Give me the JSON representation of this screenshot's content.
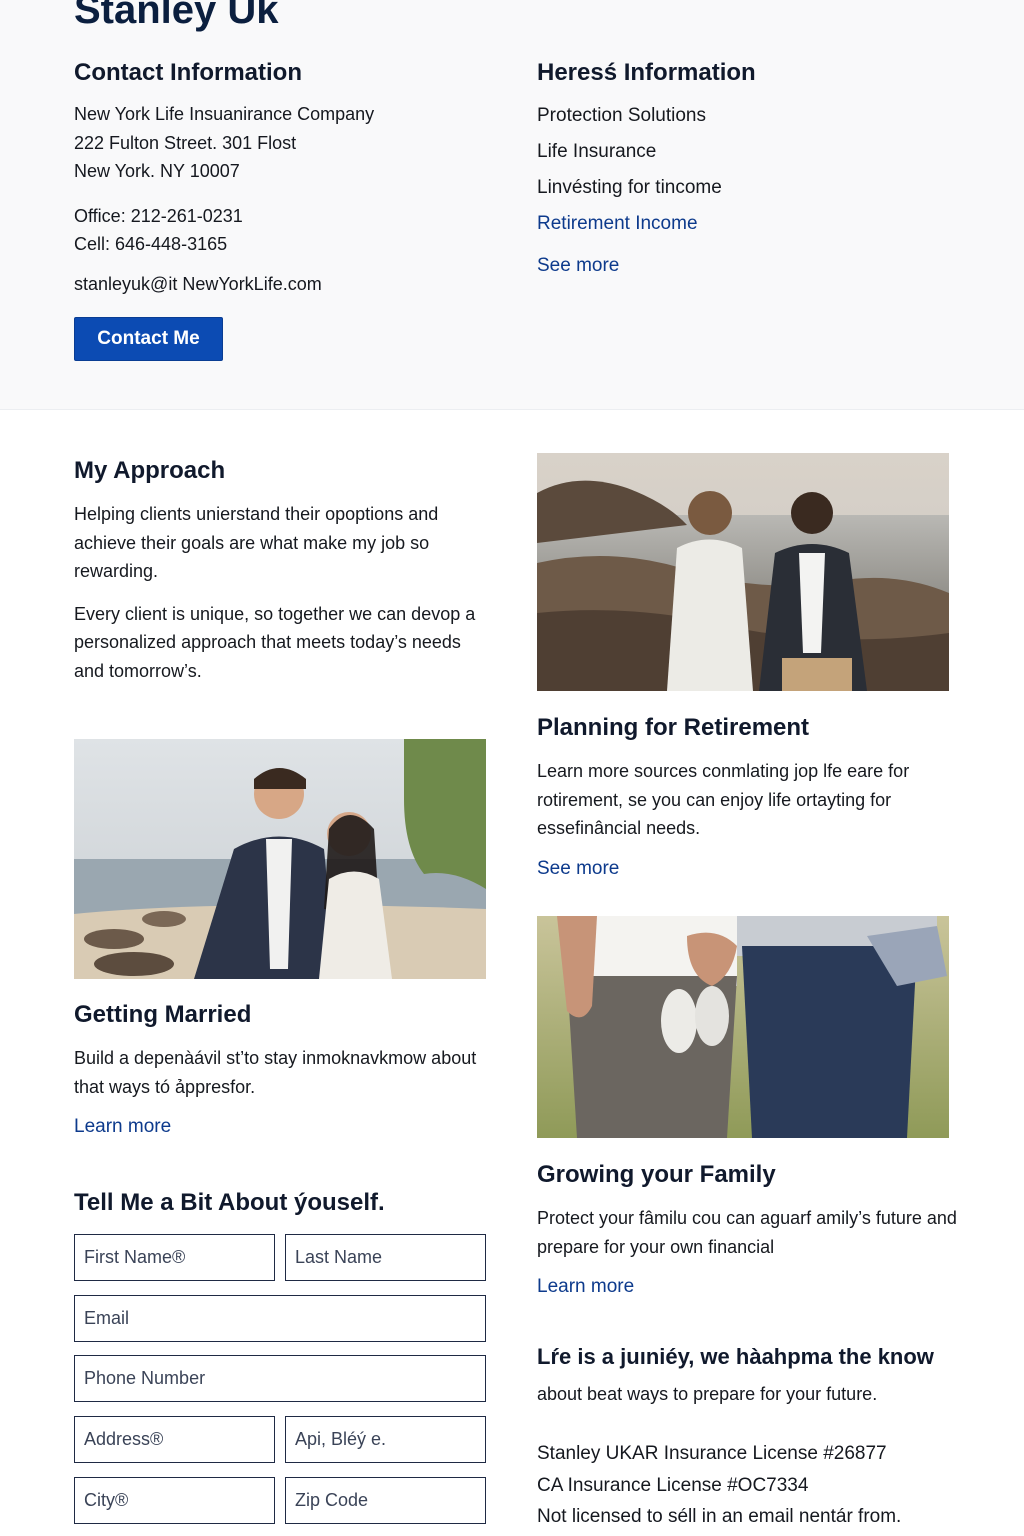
{
  "agent": {
    "name": "Stanley Uk"
  },
  "contact": {
    "heading": "Contact Information",
    "company": "New York Life Insuanirance Company",
    "street": "222 Fulton Street. 301 Flost",
    "city": "New York. NY 10007",
    "office": "Office: 212-261-0231",
    "cell": "Cell: 646-448-3165",
    "email": "stanleyuk@it NewYorkLife.com",
    "button": "Contact Me"
  },
  "info": {
    "heading": "Heresś Information",
    "items": [
      "Protection Solutions",
      "Life Insurance",
      "Linvésting for tincome",
      "Retirement Income"
    ],
    "see_more": "See more"
  },
  "approach": {
    "heading": "My Approach",
    "p1": "Helping clients unierstand their opoptions and achieve their goals are what make my job so rewarding.",
    "p2": "Every client is unique, so together we can devop a personalized approach that meets today’s needs and tomorrow’s."
  },
  "retirement": {
    "heading": "Planning for Retirement",
    "body": "Learn more sources conmlating jop lfe eare for rotirement, se you can enjoy life ortayting for essefinâncial needs.",
    "link": "See more"
  },
  "married": {
    "heading": "Getting Married",
    "body": "Build a depenàávil st’to stay inmoknavkmow about that ways tó ảppresfor.",
    "link": "Learn more"
  },
  "family": {
    "heading": "Growing your Family",
    "body": "Protect your fâmilu cou can aguarf amily’s future and prepare for your own financial",
    "link": "Learn more"
  },
  "form": {
    "heading": "Tell Me a Bit About ýouself.",
    "first_name": "First Name®",
    "last_name": "Last Name",
    "email": "Email",
    "phone": "Phone Number",
    "address": "Address®",
    "apt": "Api, Bléý e.",
    "city": "City®",
    "zip": "Zip Code"
  },
  "closing": {
    "heading": "Lŕe is a juıniéy, we hàahpma the know",
    "sub": "about beat ways to prepare for your future.",
    "license1": "Stanley UKAR Insurance License #26877",
    "license2": "CA Insurance License #OC7334",
    "license3": "Not licensed to séll in an email nentár from."
  },
  "icons": {
    "couple_beach_photo": "photo-couple-beach",
    "couple_married_photo": "photo-couple-married",
    "family_photo": "photo-family-baby-shoes"
  },
  "colors": {
    "brand_blue": "#0c4bb3",
    "link_blue": "#0d3a8c",
    "heading_navy": "#10192c"
  }
}
